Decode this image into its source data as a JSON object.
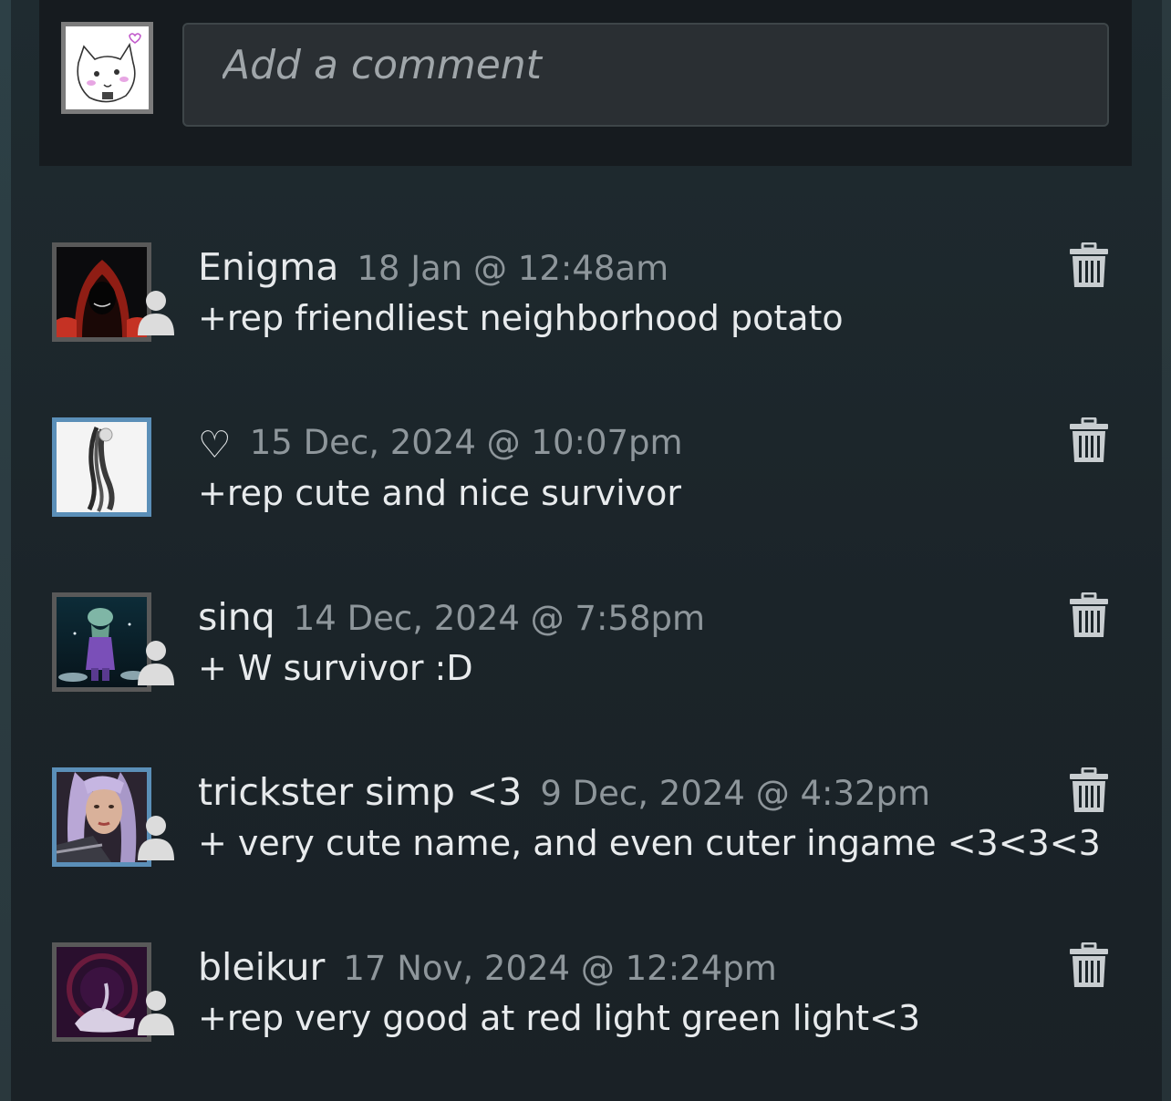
{
  "composer": {
    "placeholder": "Add a comment",
    "avatar_icon": "cat-sketch-avatar"
  },
  "comments": [
    {
      "author": "Enigma",
      "timestamp": "18 Jan @ 12:48am",
      "text": "+rep friendliest neighborhood potato",
      "avatar_icon": "red-hood-avatar",
      "online": false,
      "friend_badge": true
    },
    {
      "author": "♡",
      "timestamp": "15 Dec, 2024 @ 10:07pm",
      "text": "+rep cute and nice survivor",
      "avatar_icon": "hair-avatar",
      "online": true,
      "friend_badge": false
    },
    {
      "author": "sinq",
      "timestamp": "14 Dec, 2024 @ 7:58pm",
      "text": "+ W survivor :D",
      "avatar_icon": "squid-avatar",
      "online": false,
      "friend_badge": true
    },
    {
      "author": "trickster simp <3",
      "timestamp": "9 Dec, 2024 @ 4:32pm",
      "text": "+ very cute name, and even cuter ingame <3<3<3",
      "avatar_icon": "purple-hair-avatar",
      "online": true,
      "friend_badge": true
    },
    {
      "author": "bleikur",
      "timestamp": "17 Nov, 2024 @ 12:24pm",
      "text": "+rep very good at red light green light<3",
      "avatar_icon": "dark-purple-avatar",
      "online": false,
      "friend_badge": true
    }
  ],
  "colors": {
    "background": "#1b2429",
    "composer_bg": "#161b1f",
    "author": "#e6e9eb",
    "timestamp": "#8e969b",
    "online_border": "#5b8fb8",
    "offline_border": "#595959"
  },
  "icons": {
    "delete": "trash-icon",
    "friend": "friend-icon"
  }
}
